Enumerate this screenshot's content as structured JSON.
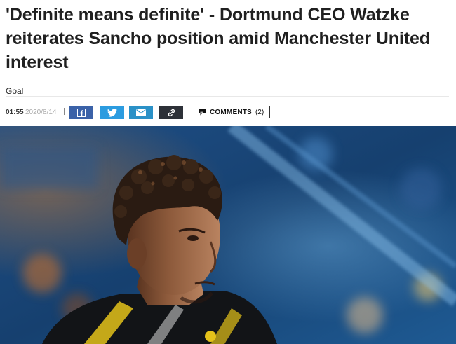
{
  "article": {
    "headline": "'Definite means definite' - Dortmund CEO Watzke reiterates Sancho position amid Manchester United interest",
    "source": "Goal",
    "time": "01:55",
    "date": "2020/8/14"
  },
  "share": {
    "facebook_icon": "facebook-icon",
    "twitter_icon": "twitter-icon",
    "email_icon": "email-icon",
    "link_icon": "link-icon"
  },
  "comments": {
    "label": "COMMENTS",
    "count": "(2)",
    "icon": "speech-bubble-icon"
  },
  "colors": {
    "facebook": "#3b62a8",
    "twitter": "#2c9ce0",
    "email": "#2b91c7",
    "link": "#2d3138"
  }
}
